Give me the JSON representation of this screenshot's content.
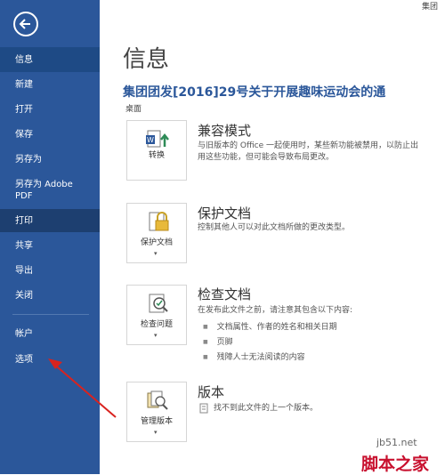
{
  "window": {
    "corner_text": "集团"
  },
  "sidebar": {
    "items": [
      {
        "label": "信息"
      },
      {
        "label": "新建"
      },
      {
        "label": "打开"
      },
      {
        "label": "保存"
      },
      {
        "label": "另存为"
      },
      {
        "label": "另存为 Adobe PDF"
      },
      {
        "label": "打印"
      },
      {
        "label": "共享"
      },
      {
        "label": "导出"
      },
      {
        "label": "关闭"
      },
      {
        "label": "帐户"
      },
      {
        "label": "选项"
      }
    ]
  },
  "main": {
    "title": "信息",
    "doc_title": "集团团发[2016]29号关于开展趣味运动会的通",
    "doc_location": "桌面",
    "sections": [
      {
        "button_label": "转换",
        "title": "兼容模式",
        "desc": [
          "与旧版本的 Office 一起使用时，某些新功能被禁用，以防止出",
          "用这些功能，但可能会导致布局更改。"
        ]
      },
      {
        "button_label": "保护文档",
        "title": "保护文档",
        "desc": [
          "控制其他人可以对此文档所做的更改类型。"
        ]
      },
      {
        "button_label": "检查问题",
        "title": "检查文档",
        "desc": [
          "在发布此文件之前，请注意其包含以下内容:"
        ],
        "bullets": [
          "文档属性、作者的姓名和相关日期",
          "页脚",
          "残障人士无法阅读的内容"
        ]
      },
      {
        "button_label": "管理版本",
        "title": "版本",
        "desc": [
          "找不到此文件的上一个版本。"
        ]
      }
    ]
  },
  "watermark": {
    "line1": "jb51.net",
    "line2": "脚本之家"
  },
  "colors": {
    "sidebar": "#2b579a",
    "accent": "#2b579a"
  }
}
